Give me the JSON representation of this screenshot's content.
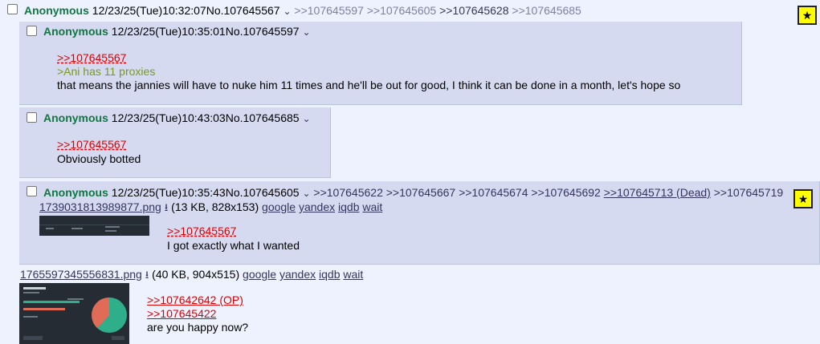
{
  "op": {
    "name": "Anonymous",
    "datetime": "12/23/25(Tue)10:32:07",
    "no": "No.107645567",
    "backlinks": [
      ">>107645597",
      ">>107645605",
      ">>107645628",
      ">>107645685"
    ]
  },
  "reply1": {
    "name": "Anonymous",
    "datetime": "12/23/25(Tue)10:35:01",
    "no": "No.107645597",
    "quote": ">>107645567",
    "greentext": ">Ani has 11 proxies",
    "text": "that means the jannies will have to nuke him 11 times and he'll be out for good, I think it can be done in a month, let's hope so"
  },
  "reply2": {
    "name": "Anonymous",
    "datetime": "12/23/25(Tue)10:43:03",
    "no": "No.107645685",
    "quote": ">>107645567",
    "text": "Obviously botted"
  },
  "reply3": {
    "name": "Anonymous",
    "datetime": "12/23/25(Tue)10:35:43",
    "no": "No.107645605",
    "backlinks": [
      ">>107645622",
      ">>107645667",
      ">>107645674",
      ">>107645692",
      ">>107645713 (Dead)",
      ">>107645719"
    ],
    "file_name": "1739031813989877.png",
    "file_info": "(13 KB, 828x153)",
    "file_links": [
      "google",
      "yandex",
      "iqdb",
      "wait"
    ],
    "quote": ">>107645567",
    "text": "I got exactly what I wanted"
  },
  "post4": {
    "file_name": "1765597345556831.png",
    "file_info": "(40 KB, 904x515)",
    "file_links": [
      "google",
      "yandex",
      "iqdb",
      "wait"
    ],
    "quotes": [
      ">>107642642 (OP)",
      ">>107645422"
    ],
    "text": "are you happy now?"
  },
  "icons": {
    "star": "★",
    "caret": "⌄",
    "download": "download-icon"
  },
  "colors": {
    "name": "#117743",
    "quote": "#dd0000",
    "greentext": "#789922",
    "reply_bg": "#d6daf0",
    "page_bg": "#eef2ff"
  }
}
